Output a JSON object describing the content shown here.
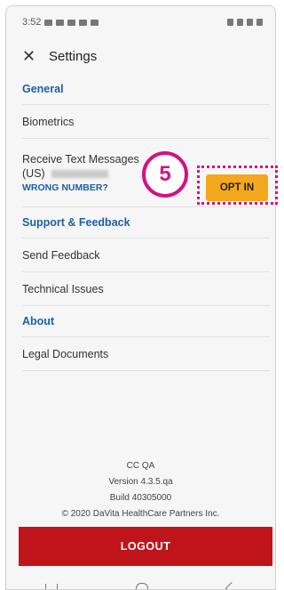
{
  "status_bar": {
    "time": "3:52"
  },
  "header": {
    "close_icon": "close-icon",
    "title": "Settings"
  },
  "sections": {
    "general": {
      "title": "General",
      "biometrics": "Biometrics",
      "sms_label": "Receive Text Messages",
      "sms_country": "(US)",
      "wrong_number": "WRONG NUMBER?",
      "opt_in": "OPT IN"
    },
    "support": {
      "title": "Support & Feedback",
      "send_feedback": "Send Feedback",
      "technical_issues": "Technical Issues"
    },
    "about": {
      "title": "About",
      "legal": "Legal Documents"
    }
  },
  "annotation": {
    "step": "5",
    "color": "#d4137f"
  },
  "footer": {
    "env": "CC QA",
    "version": "Version 4.3.5.qa",
    "build": "Build 40305000",
    "copyright": "© 2020 DaVita HealthCare Partners Inc."
  },
  "logout": {
    "label": "LOGOUT"
  },
  "colors": {
    "accent": "#1d5fa8",
    "logout": "#c0141b",
    "opt_in": "#f4a81d"
  }
}
